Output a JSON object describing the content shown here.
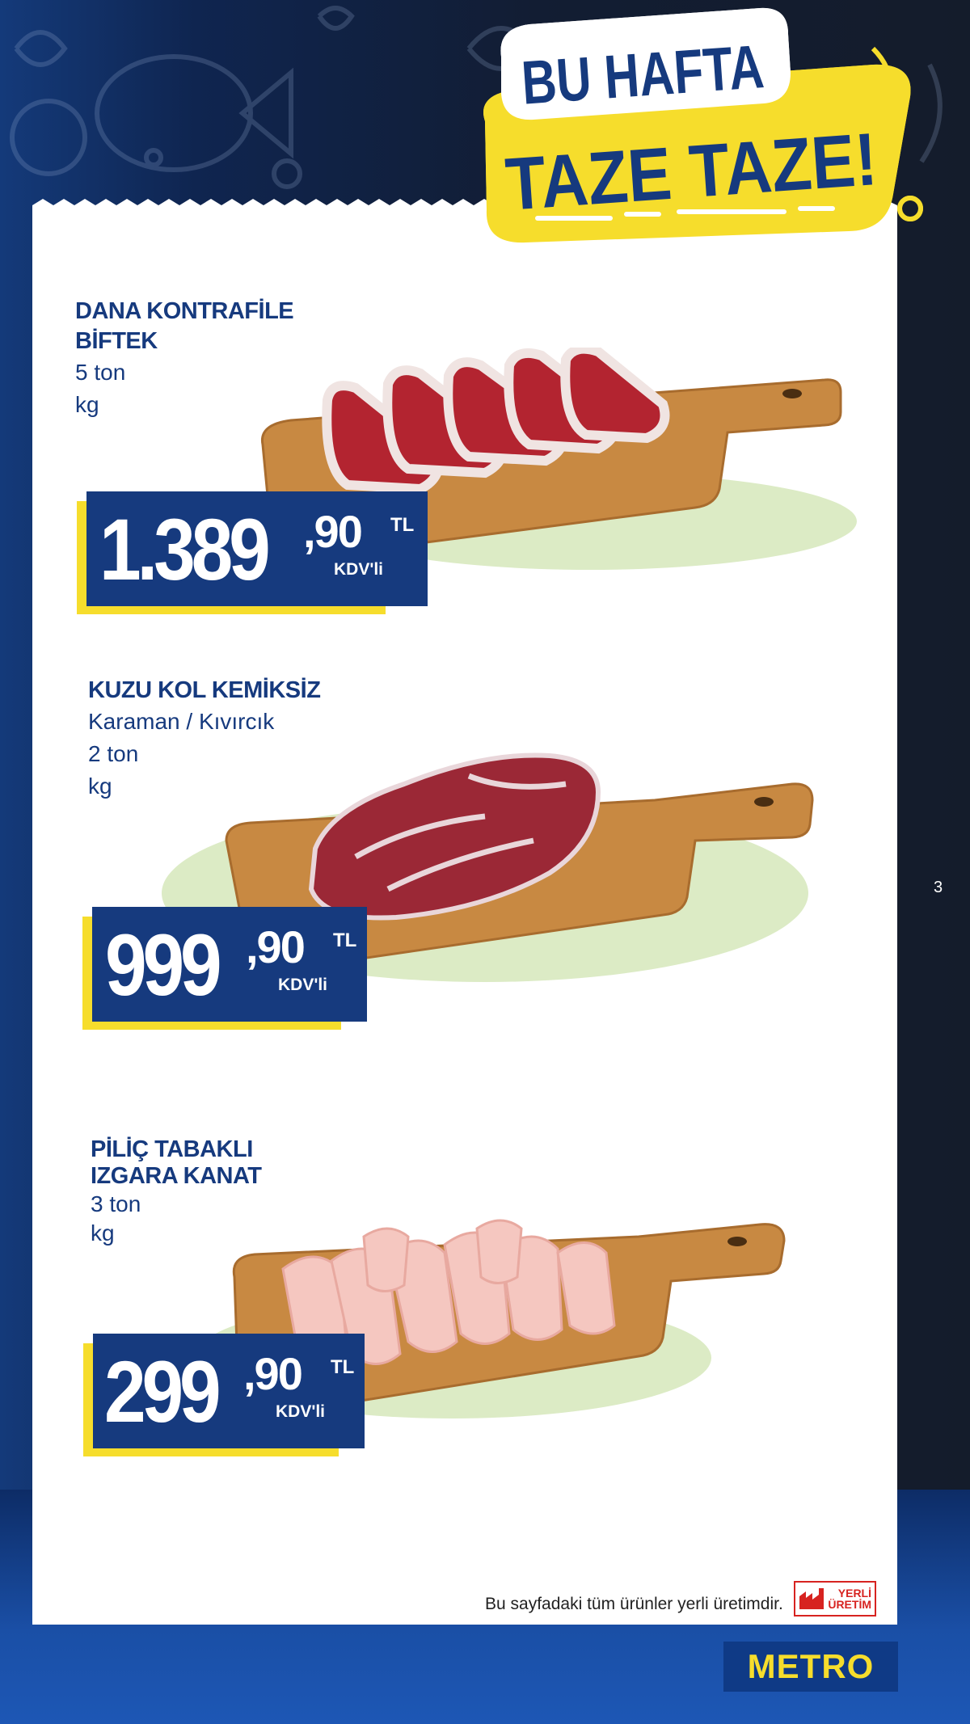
{
  "banner": {
    "line1": "BU HAFTA",
    "line2": "TAZE TAZE!"
  },
  "products": [
    {
      "name": "DANA KONTRAFİLE\nBİFTEK",
      "desc": [
        "5 ton",
        "kg"
      ],
      "price": {
        "integer": "1.389",
        "decimal": ",90",
        "currency": "TL",
        "vat": "KDV'li"
      }
    },
    {
      "name": "KUZU KOL KEMİKSİZ",
      "desc": [
        "Karaman / Kıvırcık",
        "2 ton",
        "kg"
      ],
      "price": {
        "integer": "999",
        "decimal": ",90",
        "currency": "TL",
        "vat": "KDV'li"
      }
    },
    {
      "name": "PİLİÇ TABAKLI\nIZGARA KANAT",
      "desc": [
        "3 ton",
        "kg"
      ],
      "price": {
        "integer": "299",
        "decimal": ",90",
        "currency": "TL",
        "vat": "KDV'li"
      }
    }
  ],
  "page_number": "3",
  "footer": {
    "note": "Bu sayfadaki tüm ürünler yerli üretimdir.",
    "badge_line1": "YERLİ",
    "badge_line2": "ÜRETİM"
  },
  "brand": "METRO",
  "colors": {
    "navy": "#163a7e",
    "yellow": "#f6dd2c",
    "badge_red": "#d72320"
  }
}
